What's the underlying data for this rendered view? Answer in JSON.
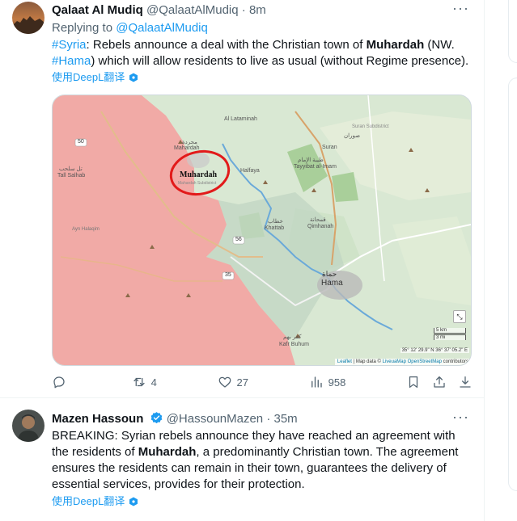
{
  "tweets": [
    {
      "display_name": "Qalaat Al Mudiq",
      "handle": "@QalaatAlMudiq",
      "time": "8m",
      "replying_label": "Replying to",
      "replying_handle": "@QalaatAlMudiq",
      "text": {
        "hashtag1": "#Syria",
        "seg1": ": Rebels announce a deal with the Christian town of ",
        "bold": "Muhardah",
        "seg2": " (NW. ",
        "hashtag2": "#Hama",
        "seg3": ") which will allow residents to live as usual (without Regime presence)."
      },
      "translate_label": "使用DeepL翻译",
      "map": {
        "labels": {
          "al_lataminah": "Al Lataminah",
          "suran_ar": "صوران",
          "suran_sub_ar": "Suran Subdistrict",
          "suran": "Suran",
          "mahardah_ar": "محردة",
          "mahardah": "Mahardah",
          "muhardah": "Muhardah",
          "mahardah_sub": "Mahardah Subdistrict",
          "tayyibat_ar": "طيبة الإمام",
          "tayyibat": "Tayyibat al-Imam",
          "halfaya": "Halfaya",
          "tall_salhab_ar": "تل سلحب",
          "tall_salhab": "Tall Salhab",
          "khattab_ar": "خطاب",
          "khattab": "Khattab",
          "qimhanah_ar": "قمحانة",
          "qimhanah": "Qimhanah",
          "hama_ar": "حماة",
          "hama": "Hama",
          "ayn_halaqim": "Ayn Halaqim",
          "kafr_buhum": "Kafr Buhum",
          "kafr_buhum_ar": "كفر بهم",
          "road_50": "50",
          "road_56": "56",
          "road_35": "35",
          "scale_km": "5 km",
          "scale_mi": "3 mi",
          "coords": "35° 12' 29.9\" N 36° 37' 05.2\" E",
          "attribution": "Leaflet | Map data © LiveuaMap OpenStreetMap contributors",
          "leaflet": "Leaflet",
          "map_data_prefix": " | Map data © ",
          "liveuamap": "LiveuaMap",
          "osm": "OpenStreetMap",
          "contributors": " contributors"
        }
      },
      "actions": {
        "replies": "",
        "retweets": "4",
        "likes": "27",
        "views": "958"
      }
    },
    {
      "display_name": "Mazen Hassoun",
      "handle": "@HassounMazen",
      "time": "35m",
      "text": {
        "seg1": "BREAKING: Syrian rebels announce they have reached an agreement with the residents of ",
        "bold": "Muhardah",
        "seg2": ", a predominantly Christian town. The agreement ensures the residents can remain in their town, guarantees the delivery of essential services, provides for their protection."
      },
      "translate_label": "使用DeepL翻译"
    }
  ],
  "colors": {
    "accent": "#1d9bf0",
    "rebel_area": "#f2a6a3",
    "regime_area": "#c9e3c6",
    "verified": "#1d9bf0"
  }
}
